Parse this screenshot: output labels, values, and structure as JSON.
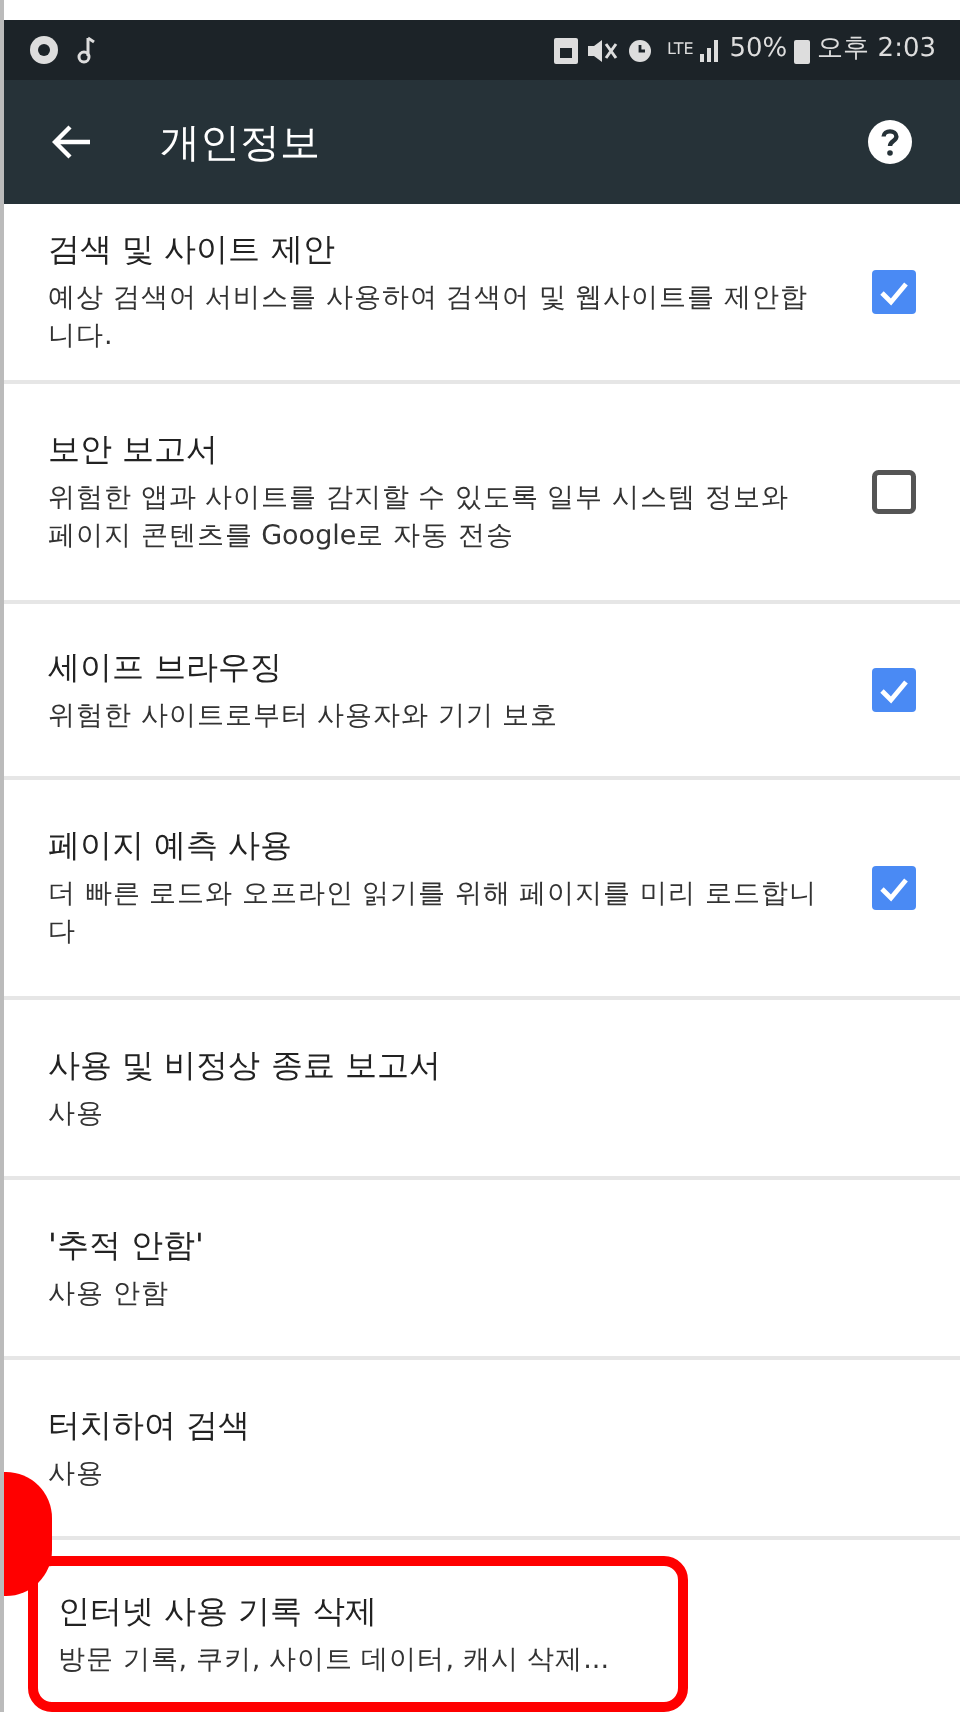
{
  "status_bar": {
    "network": "LTE",
    "battery": "50%",
    "time": "오후 2:03"
  },
  "toolbar": {
    "title": "개인정보"
  },
  "settings": [
    {
      "kind": "checkbox",
      "title": "검색 및 사이트 제안",
      "summary": "예상 검색어 서비스를 사용하여 검색어 및 웹사이트를 제안합니다.",
      "checked": true,
      "highlighted": false
    },
    {
      "kind": "checkbox",
      "title": "보안 보고서",
      "summary": "위험한 앱과 사이트를 감지할 수 있도록 일부 시스템 정보와 페이지 콘텐츠를 Google로 자동 전송",
      "checked": false,
      "highlighted": false
    },
    {
      "kind": "checkbox",
      "title": "세이프 브라우징",
      "summary": "위험한 사이트로부터 사용자와 기기 보호",
      "checked": true,
      "highlighted": false
    },
    {
      "kind": "checkbox",
      "title": "페이지 예측 사용",
      "summary": "더 빠른 로드와 오프라인 읽기를 위해 페이지를 미리 로드합니다",
      "checked": true,
      "highlighted": false
    },
    {
      "kind": "value",
      "title": "사용 및 비정상 종료 보고서",
      "summary": "사용",
      "highlighted": false
    },
    {
      "kind": "value",
      "title": "'추적 안함'",
      "summary": "사용 안함",
      "highlighted": false
    },
    {
      "kind": "value",
      "title": "터치하여 검색",
      "summary": "사용",
      "highlighted": false
    },
    {
      "kind": "value",
      "title": "인터넷 사용 기록 삭제",
      "summary": "방문 기록, 쿠키, 사이트 데이터, 캐시 삭제...",
      "highlighted": true
    }
  ]
}
